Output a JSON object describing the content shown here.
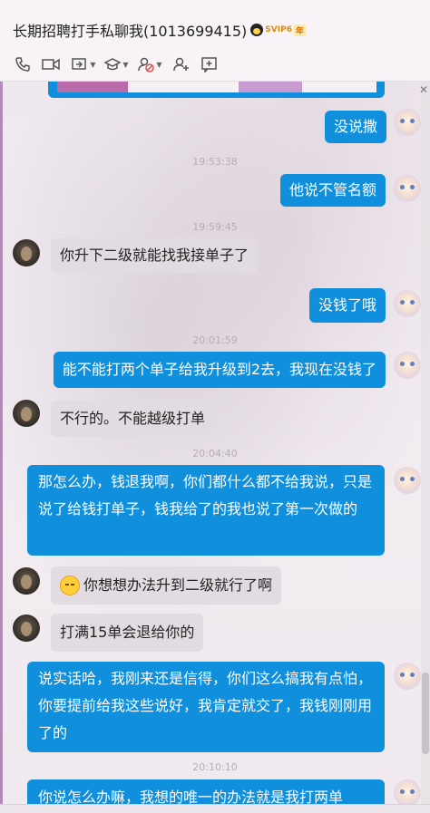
{
  "window": {
    "title": "长期招聘打手私聊我(1013699415)",
    "vip_label": "SVIP6",
    "year_label": "年"
  },
  "toolbar": {
    "icons": [
      "phone-icon",
      "video-icon",
      "share-screen-icon",
      "remote-assist-icon",
      "block-icon",
      "add-friend-icon",
      "more-apps-icon"
    ]
  },
  "colors": {
    "outgoing_bubble": "#0f8fdc",
    "incoming_bubble": "#e3dbe2",
    "accent": "#b08bb8"
  },
  "messages": [
    {
      "side": "out",
      "text": "没说撒"
    },
    {
      "timestamp": "19:53:38"
    },
    {
      "side": "out",
      "text": "他说不管名额"
    },
    {
      "timestamp": "19:59:45"
    },
    {
      "side": "in",
      "text": "你升下二级就能找我接单子了"
    },
    {
      "side": "out",
      "text": "没钱了哦"
    },
    {
      "timestamp": "20:01:59"
    },
    {
      "side": "out",
      "text": "能不能打两个单子给我升级到2去，我现在没钱了"
    },
    {
      "side": "in",
      "text": "不行的。不能越级打单"
    },
    {
      "timestamp": "20:04:40"
    },
    {
      "side": "out",
      "text": "那怎么办，钱退我啊，你们都什么都不给我说，只是说了给钱打单子，钱我给了的我也说了第一次做的"
    },
    {
      "side": "in",
      "text": "你想想办法升到二级就行了啊",
      "emoji": "doubt-emoji"
    },
    {
      "side": "in",
      "text": "打满15单会退给你的"
    },
    {
      "side": "out",
      "text": "说实话哈，我刚来还是信得，你们这么搞我有点怕，你要提前给我这些说好，我肯定就交了，我钱刚刚用了的"
    },
    {
      "timestamp": "20:10:10"
    },
    {
      "side": "out",
      "text": "你说怎么办嘛，我想的唯一的办法就是我打两单"
    }
  ]
}
